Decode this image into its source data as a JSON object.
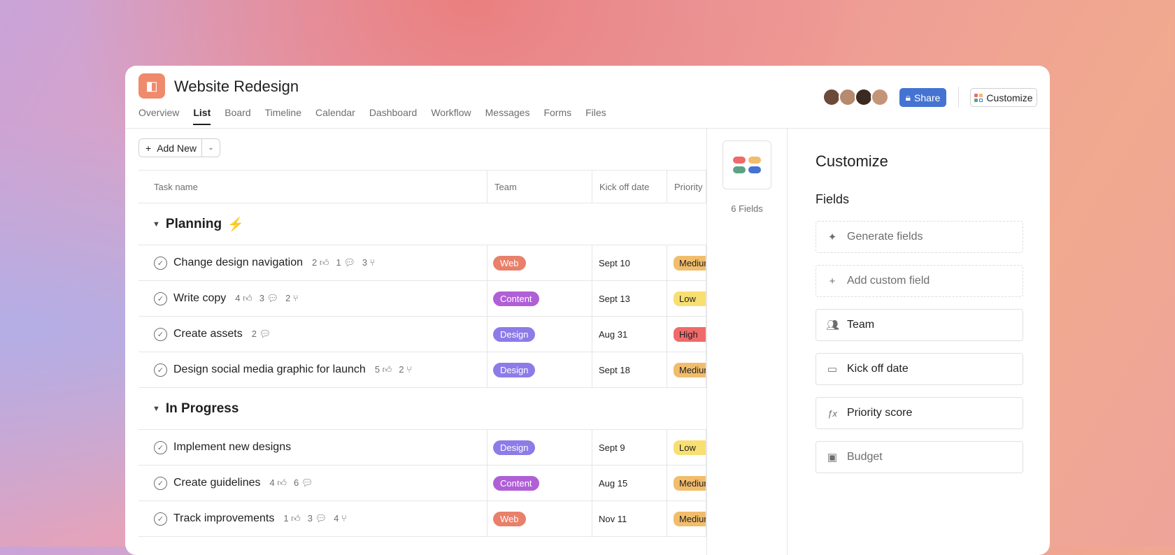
{
  "project": {
    "title": "Website Redesign",
    "icon": "megaphone-icon"
  },
  "tabs": [
    "Overview",
    "List",
    "Board",
    "Timeline",
    "Calendar",
    "Dashboard",
    "Workflow",
    "Messages",
    "Forms",
    "Files"
  ],
  "active_tab": "List",
  "header": {
    "share": "Share",
    "customize": "Customize"
  },
  "toolbar": {
    "add_new": "Add New"
  },
  "columns": [
    "Task name",
    "Team",
    "Kick off date",
    "Priority"
  ],
  "sections": [
    {
      "name": "Planning",
      "emoji": "⚡",
      "rows": [
        {
          "task": "Change design navigation",
          "likes": "2",
          "comments": "1",
          "subtasks": "3",
          "team": "Web",
          "date": "Sept 10",
          "priority": "Medium"
        },
        {
          "task": "Write copy",
          "likes": "4",
          "comments": "3",
          "subtasks": "2",
          "team": "Content",
          "date": "Sept 13",
          "priority": "Low"
        },
        {
          "task": "Create assets",
          "comments": "2",
          "team": "Design",
          "date": "Aug 31",
          "priority": "High"
        },
        {
          "task": "Design social media graphic for launch",
          "likes": "5",
          "subtasks": "2",
          "team": "Design",
          "date": "Sept 18",
          "priority": "Medium"
        }
      ]
    },
    {
      "name": "In Progress",
      "rows": [
        {
          "task": "Implement new designs",
          "team": "Design",
          "date": "Sept 9",
          "priority": "Low"
        },
        {
          "task": "Create guidelines",
          "likes": "4",
          "comments": "6",
          "team": "Content",
          "date": "Aug 15",
          "priority": "Medium"
        },
        {
          "task": "Track improvements",
          "likes": "1",
          "comments": "3",
          "subtasks": "4",
          "team": "Web",
          "date": "Nov 11",
          "priority": "Medium"
        }
      ]
    }
  ],
  "team_colors": {
    "Web": "#e8806a",
    "Content": "#b05fd6",
    "Design": "#8d7be8"
  },
  "priority_colors": {
    "Medium": "#f1bd6c",
    "Low": "#f8df72",
    "High": "#f06a6a"
  },
  "fields_panel": {
    "count_label": "6 Fields"
  },
  "customize": {
    "title": "Customize",
    "fields_label": "Fields",
    "items": [
      {
        "label": "Generate fields",
        "icon": "sparkle-icon",
        "style": "dashed"
      },
      {
        "label": "Add custom field",
        "icon": "plus-icon",
        "style": "dashed"
      },
      {
        "label": "Team",
        "icon": "people-icon"
      },
      {
        "label": "Kick off date",
        "icon": "calendar-icon"
      },
      {
        "label": "Priority score",
        "icon": "formula-icon"
      },
      {
        "label": "Budget",
        "icon": "money-icon",
        "style": "disabled"
      }
    ]
  }
}
